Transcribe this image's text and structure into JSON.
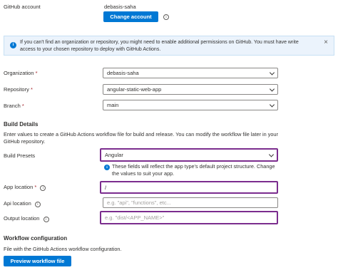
{
  "account": {
    "label": "GitHub account",
    "username": "debasis-saha",
    "change_button": "Change account"
  },
  "banner": {
    "text": "If you can't find an organization or repository, you might need to enable additional permissions on GitHub. You must have write access to your chosen repository to deploy with GitHub Actions.",
    "close": "×"
  },
  "fields": {
    "organization": {
      "label": "Organization",
      "required": "*",
      "value": "debasis-saha"
    },
    "repository": {
      "label": "Repository",
      "required": "*",
      "value": "angular-static-web-app"
    },
    "branch": {
      "label": "Branch",
      "required": "*",
      "value": "main"
    }
  },
  "build": {
    "title": "Build Details",
    "description": "Enter values to create a GitHub Actions workflow file for build and release. You can modify the workflow file later in your GitHub repository.",
    "presets_label": "Build Presets",
    "presets_value": "Angular",
    "presets_hint": "These fields will reflect the app type's default project structure. Change the values to suit your app.",
    "app_location_label": "App location",
    "app_location_required": "*",
    "app_location_value": "/",
    "api_location_label": "Api location",
    "api_location_placeholder": "e.g. \"api\", \"functions\", etc...",
    "output_location_label": "Output location",
    "output_location_placeholder": "e.g. \"dist/<APP_NAME>\""
  },
  "workflow": {
    "title": "Workflow configuration",
    "description": "File with the GitHub Actions workflow configuration.",
    "preview_button": "Preview workflow file"
  },
  "colors": {
    "accent": "#0078d4",
    "highlight": "#7b2d8e",
    "banner_bg": "#ebf3fc"
  },
  "icons": [
    "info-icon",
    "close-icon",
    "chevron-down-icon"
  ]
}
